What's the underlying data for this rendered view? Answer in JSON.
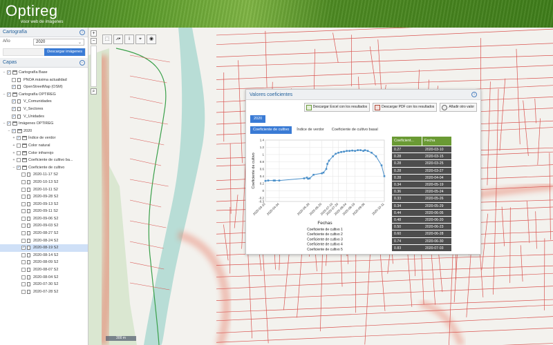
{
  "header": {
    "title": "Optireg",
    "subtitle": "visor web de imágenes"
  },
  "cartografia": {
    "title": "Cartografía",
    "year_label": "Año",
    "year_value": "2020",
    "download_label": "Descargar imágenes"
  },
  "capas": {
    "title": "Capas",
    "items": [
      {
        "label": "Cartografía Base",
        "level": 0,
        "expander": "−",
        "checked": true,
        "icon": "folder"
      },
      {
        "label": "PNOA máxima actualidad",
        "level": 1,
        "expander": "",
        "checked": false,
        "icon": "doc"
      },
      {
        "label": "OpenStreetMap (OSM)",
        "level": 1,
        "expander": "",
        "checked": true,
        "icon": "doc"
      },
      {
        "label": "Cartografía OPTIREG",
        "level": 0,
        "expander": "−",
        "checked": true,
        "icon": "folder"
      },
      {
        "label": "V_Comunidades",
        "level": 1,
        "expander": "",
        "checked": true,
        "icon": "doc"
      },
      {
        "label": "V_Sectores",
        "level": 1,
        "expander": "",
        "checked": true,
        "icon": "doc"
      },
      {
        "label": "V_Unidades",
        "level": 1,
        "expander": "",
        "checked": true,
        "icon": "doc"
      },
      {
        "label": "Imágenes OPTIREG",
        "level": 0,
        "expander": "−",
        "checked": true,
        "icon": "folder"
      },
      {
        "label": "2020",
        "level": 1,
        "expander": "−",
        "checked": true,
        "icon": "folder"
      },
      {
        "label": "Índice de verdor",
        "level": 2,
        "expander": "+",
        "checked": true,
        "icon": "folder"
      },
      {
        "label": "Color natural",
        "level": 2,
        "expander": "+",
        "checked": false,
        "icon": "folder"
      },
      {
        "label": "Color infrarrojo",
        "level": 2,
        "expander": "+",
        "checked": false,
        "icon": "folder"
      },
      {
        "label": "Coeficiente de cultivo ba...",
        "level": 2,
        "expander": "+",
        "checked": false,
        "icon": "folder"
      },
      {
        "label": "Coeficiente de cultivo",
        "level": 2,
        "expander": "−",
        "checked": true,
        "icon": "folder"
      },
      {
        "label": "2020-11-17 S2",
        "level": 3,
        "expander": "",
        "checked": false,
        "icon": "doc"
      },
      {
        "label": "2020-10-13 S2",
        "level": 3,
        "expander": "",
        "checked": false,
        "icon": "doc"
      },
      {
        "label": "2020-10-11 S2",
        "level": 3,
        "expander": "",
        "checked": false,
        "icon": "doc"
      },
      {
        "label": "2020-09-28 S2",
        "level": 3,
        "expander": "",
        "checked": false,
        "icon": "doc"
      },
      {
        "label": "2020-09-13 S2",
        "level": 3,
        "expander": "",
        "checked": false,
        "icon": "doc"
      },
      {
        "label": "2020-09-11 S2",
        "level": 3,
        "expander": "",
        "checked": false,
        "icon": "doc"
      },
      {
        "label": "2020-09-06 S2",
        "level": 3,
        "expander": "",
        "checked": false,
        "icon": "doc"
      },
      {
        "label": "2020-09-03 S2",
        "level": 3,
        "expander": "",
        "checked": false,
        "icon": "doc"
      },
      {
        "label": "2020-08-27 S2",
        "level": 3,
        "expander": "",
        "checked": false,
        "icon": "doc"
      },
      {
        "label": "2020-08-24 S2",
        "level": 3,
        "expander": "",
        "checked": false,
        "icon": "doc"
      },
      {
        "label": "2020-08-19 S2",
        "level": 3,
        "expander": "",
        "checked": true,
        "icon": "doc",
        "selected": true
      },
      {
        "label": "2020-08-14 S2",
        "level": 3,
        "expander": "",
        "checked": false,
        "icon": "doc"
      },
      {
        "label": "2020-08-09 S2",
        "level": 3,
        "expander": "",
        "checked": false,
        "icon": "doc"
      },
      {
        "label": "2020-08-07 S2",
        "level": 3,
        "expander": "",
        "checked": false,
        "icon": "doc"
      },
      {
        "label": "2020-08-04 S2",
        "level": 3,
        "expander": "",
        "checked": false,
        "icon": "doc"
      },
      {
        "label": "2020-07-30 S2",
        "level": 3,
        "expander": "",
        "checked": false,
        "icon": "doc"
      },
      {
        "label": "2020-07-28 S2",
        "level": 3,
        "expander": "",
        "checked": false,
        "icon": "doc"
      }
    ]
  },
  "map": {
    "zoom_in": "+",
    "zoom_out": "−",
    "tools": [
      "select-tool",
      "measure-tool",
      "info-tool",
      "locate-tool",
      "layers-tool"
    ],
    "scale_label": "300 m"
  },
  "dialog": {
    "title": "Valores coeficientes",
    "excel_label": "Descargar Excel con los resultados",
    "pdf_label": "Descargar PDF con los resultados",
    "add_label": "Añadir otro valor",
    "year_tab": "2020",
    "tabs": [
      "Coeficiente de cultivo",
      "Índice de verdor",
      "Coeficiente de cultivo basal"
    ],
    "active_tab": 0,
    "table": {
      "headers": [
        "Coeficient...",
        "Fecha"
      ],
      "rows": [
        [
          "0.27",
          "2020-03-10"
        ],
        [
          "0.28",
          "2020-03-15"
        ],
        [
          "0.28",
          "2020-03-25"
        ],
        [
          "0.28",
          "2020-03-27"
        ],
        [
          "0.28",
          "2020-04-04"
        ],
        [
          "0.34",
          "2020-05-19"
        ],
        [
          "0.36",
          "2020-05-24"
        ],
        [
          "0.33",
          "2020-05-26"
        ],
        [
          "0.34",
          "2020-05-29"
        ],
        [
          "0.44",
          "2020-06-05"
        ],
        [
          "0.48",
          "2020-06-20"
        ],
        [
          "0.50",
          "2020-06-23"
        ],
        [
          "0.60",
          "2020-06-28"
        ],
        [
          "0.74",
          "2020-06-30"
        ],
        [
          "0.83",
          "2020-07-03"
        ]
      ]
    }
  },
  "chart_data": {
    "type": "line",
    "xlabel": "Fechas",
    "ylabel": "Coeficiente de cultivo",
    "ylim": [
      -0.3,
      1.4
    ],
    "yticks": [
      "-0.3",
      "-0.2",
      "0",
      "0.2",
      "0.4",
      "0.6",
      "0.8",
      "1",
      "1.2",
      "1.4"
    ],
    "xticks": [
      "2020-03-10",
      "2020-04-04",
      "2020-05-29",
      "2020-06-20",
      "2020-07-10",
      "2020-07-20",
      "2020-08-04",
      "2020-08-19",
      "2020-09-06",
      "2020-10-11"
    ],
    "x": [
      "2020-03-10",
      "2020-03-15",
      "2020-03-25",
      "2020-03-27",
      "2020-04-04",
      "2020-05-19",
      "2020-05-24",
      "2020-05-26",
      "2020-05-29",
      "2020-06-05",
      "2020-06-20",
      "2020-06-23",
      "2020-06-28",
      "2020-06-30",
      "2020-07-03",
      "2020-07-10",
      "2020-07-15",
      "2020-07-20",
      "2020-07-25",
      "2020-07-30",
      "2020-08-04",
      "2020-08-09",
      "2020-08-14",
      "2020-08-19",
      "2020-08-24",
      "2020-08-29",
      "2020-09-03",
      "2020-09-06",
      "2020-09-11",
      "2020-09-18",
      "2020-09-26",
      "2020-10-06",
      "2020-10-11"
    ],
    "values": [
      0.27,
      0.28,
      0.28,
      0.28,
      0.28,
      0.34,
      0.36,
      0.33,
      0.34,
      0.44,
      0.48,
      0.5,
      0.6,
      0.74,
      0.83,
      0.95,
      1.02,
      1.05,
      1.07,
      1.08,
      1.1,
      1.1,
      1.11,
      1.1,
      1.12,
      1.12,
      1.1,
      1.12,
      1.1,
      1.05,
      0.95,
      0.7,
      0.4
    ],
    "legend": [
      "Coeficiente de cultivo 1",
      "Coeficiente de cultivo 2",
      "Coeficiente de cultivo 3",
      "Coeficiente de cultivo 4",
      "Coeficiente de cultivo 5"
    ],
    "color": "#4a8fc9"
  }
}
